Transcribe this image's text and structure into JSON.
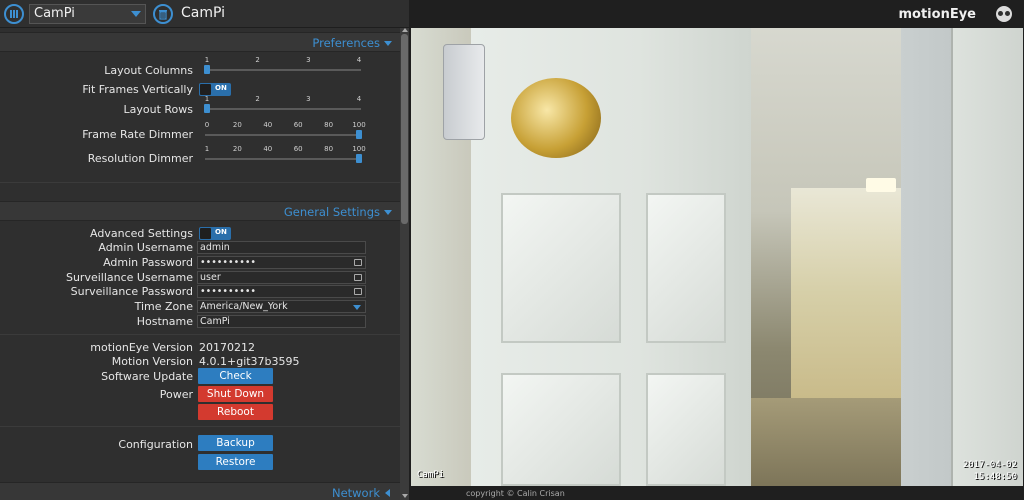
{
  "header": {
    "camera_select_value": "CamPi",
    "camera_title": "CamPi",
    "brand": "motionEye"
  },
  "sections": {
    "preferences": {
      "title": "Preferences",
      "layout_columns": {
        "label": "Layout Columns",
        "ticks": [
          "1",
          "2",
          "3",
          "4"
        ],
        "value": 1,
        "min": 1,
        "max": 4
      },
      "fit_frames": {
        "label": "Fit Frames Vertically",
        "state": "ON"
      },
      "layout_rows": {
        "label": "Layout Rows",
        "ticks": [
          "1",
          "2",
          "3",
          "4"
        ],
        "value": 1,
        "min": 1,
        "max": 4
      },
      "frame_rate_dimmer": {
        "label": "Frame Rate Dimmer",
        "ticks": [
          "0",
          "20",
          "40",
          "60",
          "80",
          "100"
        ],
        "value": 100,
        "min": 0,
        "max": 100
      },
      "resolution_dimmer": {
        "label": "Resolution Dimmer",
        "ticks": [
          "1",
          "20",
          "40",
          "60",
          "80",
          "100"
        ],
        "value": 100,
        "min": 1,
        "max": 100
      }
    },
    "general": {
      "title": "General Settings",
      "advanced_settings": {
        "label": "Advanced Settings",
        "state": "ON"
      },
      "admin_username": {
        "label": "Admin Username",
        "value": "admin"
      },
      "admin_password": {
        "label": "Admin Password",
        "value": "••••••••••"
      },
      "surveillance_username": {
        "label": "Surveillance Username",
        "value": "user"
      },
      "surveillance_password": {
        "label": "Surveillance Password",
        "value": "••••••••••"
      },
      "time_zone": {
        "label": "Time Zone",
        "value": "America/New_York"
      },
      "hostname": {
        "label": "Hostname",
        "value": "CamPi"
      },
      "motioneye_version": {
        "label": "motionEye Version",
        "value": "20170212"
      },
      "motion_version": {
        "label": "Motion Version",
        "value": "4.0.1+git37b3595"
      },
      "software_update": {
        "label": "Software Update",
        "button": "Check"
      },
      "power": {
        "label": "Power",
        "shutdown_button": "Shut Down",
        "reboot_button": "Reboot"
      },
      "configuration": {
        "label": "Configuration",
        "backup_button": "Backup",
        "restore_button": "Restore"
      }
    },
    "network": {
      "title": "Network"
    }
  },
  "video": {
    "camera_name_overlay": "CamPi",
    "date_overlay": "2017-04-02",
    "time_overlay": "15:48:50"
  },
  "footer": {
    "copyright": "copyright © Calin Crisan"
  },
  "colors": {
    "accent": "#3d8fd1",
    "danger": "#d33a2f",
    "button": "#2d7dc0"
  }
}
